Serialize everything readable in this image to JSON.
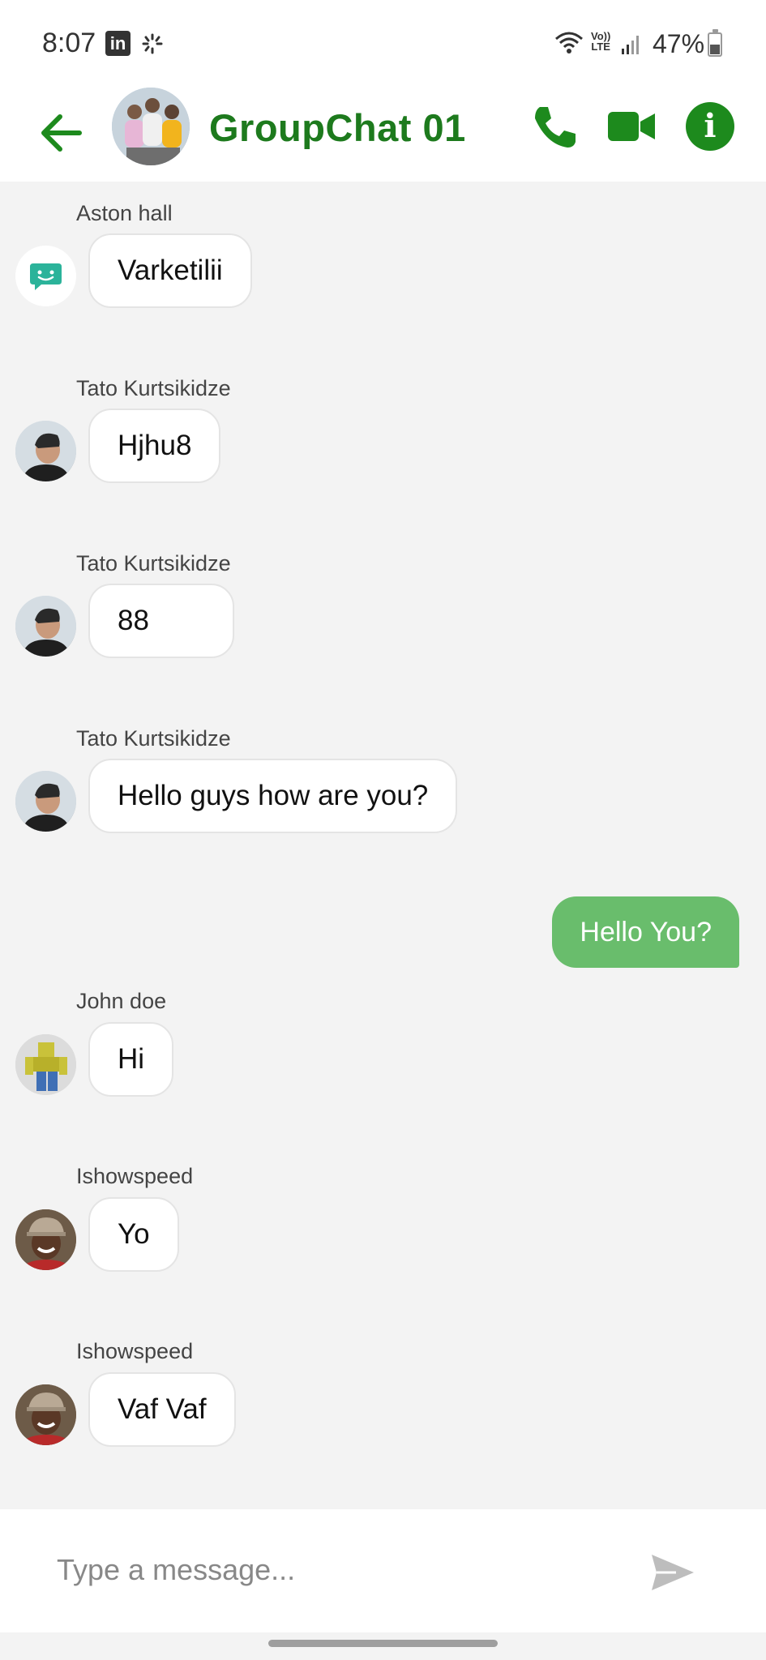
{
  "status_bar": {
    "time": "8:07",
    "linkedin_label": "in",
    "lte_label_top": "Vo))",
    "lte_label_bottom": "LTE",
    "battery": "47%"
  },
  "header": {
    "title": "GroupChat 01"
  },
  "messages": [
    {
      "sender": "Aston hall",
      "text": "Varketilii",
      "avatar": "bot-avatar"
    },
    {
      "sender": "Tato Kurtsikidze",
      "text": "Hjhu8",
      "avatar": "tato-avatar"
    },
    {
      "sender": "Tato Kurtsikidze",
      "text": "88",
      "avatar": "tato-avatar"
    },
    {
      "sender": "Tato Kurtsikidze",
      "text": "Hello guys how are you?",
      "avatar": "tato-avatar"
    },
    {
      "sender": "",
      "text": "Hello You?",
      "outgoing": true
    },
    {
      "sender": "John doe",
      "text": "Hi",
      "avatar": "john-avatar"
    },
    {
      "sender": "Ishowspeed",
      "text": "Yo",
      "avatar": "speed-avatar"
    },
    {
      "sender": "Ishowspeed",
      "text": "Vaf Vaf",
      "avatar": "speed-avatar"
    }
  ],
  "composer": {
    "placeholder": "Type a message..."
  },
  "colors": {
    "brand_green": "#1d8a1d",
    "outgoing_bubble": "#69bd6c"
  }
}
